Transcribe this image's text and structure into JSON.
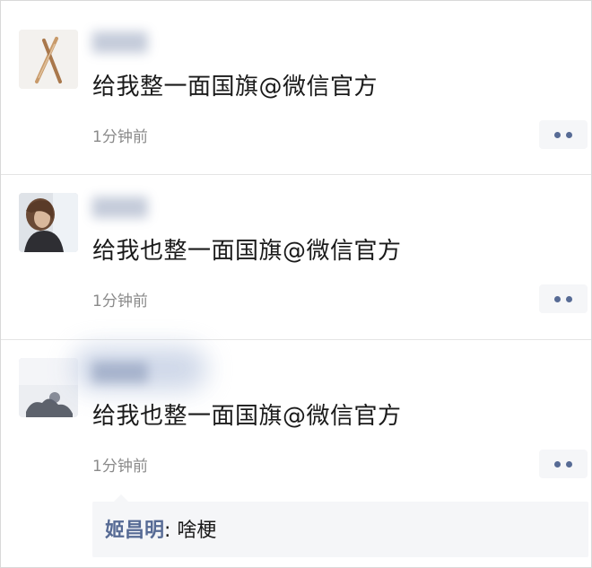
{
  "posts": [
    {
      "content": "给我整一面国旗@微信官方",
      "time": "1分钟前"
    },
    {
      "content": "给我也整一面国旗@微信官方",
      "time": "1分钟前"
    },
    {
      "content": "给我也整一面国旗@微信官方",
      "time": "1分钟前",
      "comments": [
        {
          "author": "姬昌明",
          "separator": ": ",
          "text": "啥梗"
        }
      ]
    }
  ],
  "icons": {
    "more": "more-dots-icon"
  },
  "colors": {
    "link_blue": "#576b95",
    "text": "#1a1a1a",
    "time_gray": "#8a8a8a",
    "comment_bg": "#f5f6f8"
  }
}
